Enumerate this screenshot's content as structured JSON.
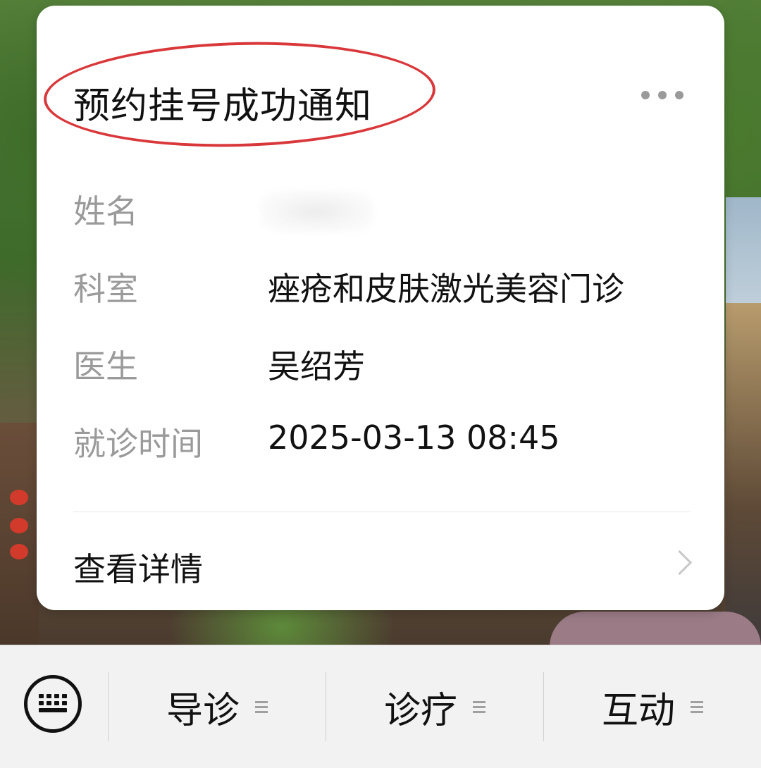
{
  "notification": {
    "title": "预约挂号成功通知",
    "more_icon": "more-dots-icon",
    "fields": [
      {
        "label": "姓名",
        "value": ""
      },
      {
        "label": "科室",
        "value": "痤疮和皮肤激光美容门诊"
      },
      {
        "label": "医生",
        "value": "吴绍芳"
      },
      {
        "label": "就诊时间",
        "value": "2025-03-13 08:45"
      }
    ],
    "detail_label": "查看详情",
    "detail_icon": "chevron-right-icon",
    "annotation_color": "#d9383b"
  },
  "menu": {
    "keyboard_icon": "keyboard-icon",
    "items": [
      {
        "label": "导诊",
        "icon": "menu-lines-icon"
      },
      {
        "label": "诊疗",
        "icon": "menu-lines-icon"
      },
      {
        "label": "互动",
        "icon": "menu-lines-icon"
      }
    ]
  }
}
